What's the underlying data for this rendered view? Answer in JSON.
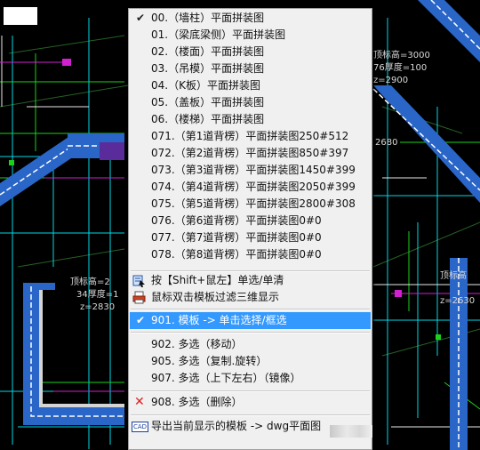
{
  "background": {
    "labels": [
      {
        "id": "t1",
        "text": "顶标高=3000"
      },
      {
        "id": "t2",
        "text": "76厚度=100"
      },
      {
        "id": "t3",
        "text": "z=2900"
      },
      {
        "id": "t4",
        "text": "顶标高=2"
      },
      {
        "id": "t5",
        "text": "34厚度=1"
      },
      {
        "id": "t6",
        "text": "z=2830"
      },
      {
        "id": "t7",
        "text": "顶标高"
      },
      {
        "id": "t8",
        "text": "z=2630"
      },
      {
        "id": "t9",
        "text": "2680"
      }
    ]
  },
  "menu": {
    "items": [
      {
        "label": "00.（墙柱）平面拼装图",
        "checked": true
      },
      {
        "label": "01.（梁底梁侧）平面拼装图",
        "checked": false
      },
      {
        "label": "02.（楼面）平面拼装图",
        "checked": false
      },
      {
        "label": "03.（吊模）平面拼装图",
        "checked": false
      },
      {
        "label": "04.（K板）平面拼装图",
        "checked": false
      },
      {
        "label": "05.（盖板）平面拼装图",
        "checked": false
      },
      {
        "label": "06.（楼梯）平面拼装图",
        "checked": false
      },
      {
        "label": "071.（第1道背楞）平面拼装图250#512",
        "checked": false
      },
      {
        "label": "072.（第2道背楞）平面拼装图850#397",
        "checked": false
      },
      {
        "label": "073.（第3道背楞）平面拼装图1450#399",
        "checked": false
      },
      {
        "label": "074.（第4道背楞）平面拼装图2050#399",
        "checked": false
      },
      {
        "label": "075.（第5道背楞）平面拼装图2800#308",
        "checked": false
      },
      {
        "label": "076.（第6道背楞）平面拼装图0#0",
        "checked": false
      },
      {
        "label": "077.（第7道背楞）平面拼装图0#0",
        "checked": false
      },
      {
        "label": "078.（第8道背楞）平面拼装图0#0",
        "checked": false
      }
    ],
    "shift_click": "按【Shift+鼠左】单选/单清",
    "dblclick_filter": "鼠标双击模板过滤三维显示",
    "check_mark": "✔",
    "select_mode": "901. 模板 -> 单击选择/框选",
    "multi_items": [
      "902. 多选（移动）",
      "905. 多选（复制.旋转）",
      "907. 多选（上下左右）（镜像）"
    ],
    "delete_label": "908. 多选（删除）",
    "delete_icon": "✕",
    "export_label": "导出当前显示的模板 -> dwg平面图",
    "export_icon": "CAD",
    "colors": {
      "highlight": "#3399ff",
      "menu_bg": "#f0f0f0",
      "cad_blue": "#2a66c8",
      "cad_cyan": "#00e0ff",
      "cad_green": "#19d219"
    }
  }
}
